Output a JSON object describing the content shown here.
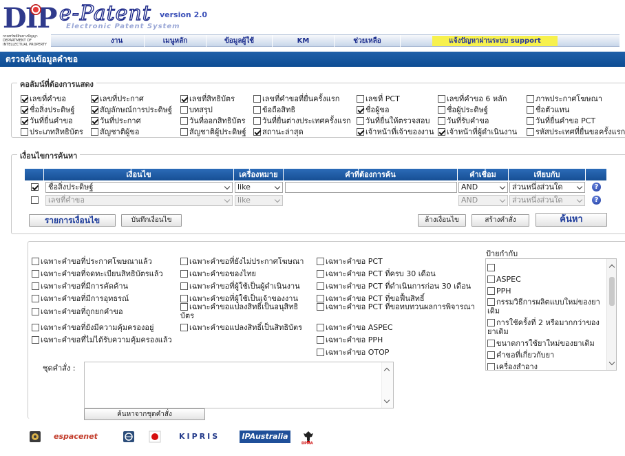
{
  "header": {
    "logo_text": "DIP",
    "logo_caption": "กรมทรัพย์สินทางปัญญา DEPARTMENT OF INTELLECTUAL PROPERTY",
    "brand": "e-Patent",
    "version": "version 2.0",
    "subtitle": "Electronic Patent System"
  },
  "nav": [
    {
      "label": "งาน"
    },
    {
      "label": "เมนูหลัก"
    },
    {
      "label": "ข้อมูลผู้ใช้"
    },
    {
      "label": "KM"
    },
    {
      "label": "ช่วยเหลือ"
    }
  ],
  "nav_support": "แจ้งปัญหาผ่านระบบ support",
  "page_title": "ตรวจค้นข้อมูลคำขอ",
  "columns_section": {
    "legend": "คอลัมน์ที่ต้องการแสดง",
    "items": [
      {
        "label": "เลขที่คำขอ",
        "checked": true
      },
      {
        "label": "เลขที่ประกาศ",
        "checked": true
      },
      {
        "label": "เลขที่สิทธิบัตร",
        "checked": true
      },
      {
        "label": "เลขที่คำขอที่ยื่นครั้งแรก",
        "checked": false
      },
      {
        "label": "เลขที่ PCT",
        "checked": false
      },
      {
        "label": "เลขที่คำขอ 6 หลัก",
        "checked": false
      },
      {
        "label": "ภาพประกาศโฆษณา",
        "checked": false
      },
      {
        "label": "ชื่อสิ่งประดิษฐ์",
        "checked": true
      },
      {
        "label": "สัญลักษณ์การประดิษฐ์",
        "checked": true
      },
      {
        "label": "บทสรุป",
        "checked": false
      },
      {
        "label": "ข้อถือสิทธิ",
        "checked": false
      },
      {
        "label": "ชื่อผู้ขอ",
        "checked": true
      },
      {
        "label": "ชื่อผู้ประดิษฐ์",
        "checked": false
      },
      {
        "label": "ชื่อตัวแทน",
        "checked": false
      },
      {
        "label": "วันที่ยื่นคำขอ",
        "checked": true
      },
      {
        "label": "วันที่ประกาศ",
        "checked": true
      },
      {
        "label": "วันที่ออกสิทธิบัตร",
        "checked": false
      },
      {
        "label": "วันที่ยื่นต่างประเทศครั้งแรก",
        "checked": false
      },
      {
        "label": "วันที่ยื่นให้ตรวจสอบ",
        "checked": false
      },
      {
        "label": "วันที่รับคำขอ",
        "checked": false
      },
      {
        "label": "วันที่ยื่นคำขอ PCT",
        "checked": false
      },
      {
        "label": "ประเภทสิทธิบัตร",
        "checked": false
      },
      {
        "label": "สัญชาติผู้ขอ",
        "checked": false
      },
      {
        "label": "สัญชาติผู้ประดิษฐ์",
        "checked": false
      },
      {
        "label": "สถานะล่าสุด",
        "checked": true
      },
      {
        "label": "เจ้าหน้าที่เจ้าของงาน",
        "checked": true
      },
      {
        "label": "เจ้าหน้าที่ผู้ดำเนินงาน",
        "checked": true
      },
      {
        "label": "รหัสประเทศที่ยื่นขอครั้งแรก",
        "checked": false
      }
    ]
  },
  "conditions": {
    "legend": "เงื่อนไขการค้นหา",
    "headers": [
      "เงื่อนไข",
      "เครื่องหมาย",
      "คำที่ต้องการค้น",
      "คำเชื่อม",
      "เทียบกับ"
    ],
    "rows": [
      {
        "checked": true,
        "field": "ชื่อสิ่งประดิษฐ์",
        "operator": "like",
        "value": "",
        "conjunction": "AND",
        "compare": "ส่วนหนึ่งส่วนใด",
        "enabled": true
      },
      {
        "checked": false,
        "field": "เลขที่คำขอ",
        "operator": "like",
        "value": "",
        "conjunction": "AND",
        "compare": "ส่วนหนึ่งส่วนใด",
        "enabled": false
      }
    ],
    "help_label": "?",
    "buttons": {
      "list_conditions": "รายการเงื่อนไข",
      "save_conditions": "บันทึกเงื่อนไข",
      "clear_conditions": "ล้างเงื่อนไข",
      "build_command": "สร้างคำสั่ง",
      "search": "ค้นหา"
    }
  },
  "filters": {
    "col1": [
      "เฉพาะคำขอที่ประกาศโฆษณาแล้ว",
      "เฉพาะคำขอที่จดทะเบียนสิทธิบัตรแล้ว",
      "เฉพาะคำขอที่มีการคัดค้าน",
      "เฉพาะคำขอที่มีการอุทธรณ์",
      "เฉพาะคำขอที่ถูกยกคำขอ",
      "เฉพาะคำขอที่ยังมีความคุ้มครองอยู่",
      "เฉพาะคำขอที่ไม่ได้รับความคุ้มครองแล้ว"
    ],
    "col2": [
      "เฉพาะคำขอที่ยังไม่ประกาศโฆษณา",
      "เฉพาะคำขอของไทย",
      "เฉพาะคำขอที่ผู้ใช้เป็นผู้ดำเนินงาน",
      "เฉพาะคำขอที่ผู้ใช้เป็นเจ้าของงาน",
      "เฉพาะคำขอแปลงสิทธิ์เป็นอนุสิทธิบัตร",
      "เฉพาะคำขอแปลงสิทธิ์เป็นสิทธิบัตร"
    ],
    "col3": [
      "เฉพาะคำขอ PCT",
      "เฉพาะคำขอ PCT ที่ครบ 30 เดือน",
      "เฉพาะคำขอ PCT ที่ดำเนินการก่อน 30 เดือน",
      "เฉพาะคำขอ PCT ที่ขอฟื้นสิทธิ์",
      "เฉพาะคำขอ PCT ที่ขอทบทวนผลการพิจารณา",
      "เฉพาะคำขอ ASPEC",
      "เฉพาะคำขอ PPH",
      "เฉพาะคำขอ OTOP"
    ]
  },
  "tags": {
    "label": "ป้ายกำกับ",
    "items": [
      "",
      "ASPEC",
      "PPH",
      "กรรมวิธีการผลิตแบบใหม่ของยาเดิม",
      "การใช้ครั้งที่ 2 หรือมากกว่าของยาเดิม",
      "ขนาดการใช้ยาใหม่ของยาเดิม",
      "คำขอที่เกี่ยวกับยา",
      "เครื่องสำอาง"
    ]
  },
  "command": {
    "label": "ชุดคำสั่ง :",
    "value": "",
    "search_button": "ค้นหาจากชุดคำสั่ง"
  },
  "footer_logos": [
    "espacenet",
    "KIPRIS",
    "IPAustralia",
    "DPMA"
  ],
  "colors": {
    "nav_text": "#1b2d8d",
    "title_bar": "#1553a0",
    "table_header": "#1f5aa6",
    "support_bg": "#f7f14d"
  }
}
